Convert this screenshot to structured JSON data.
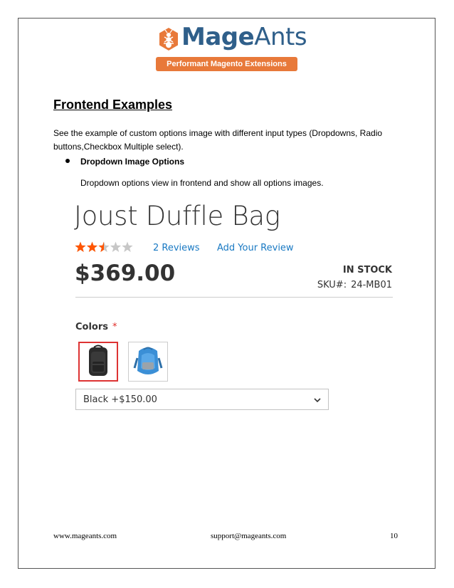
{
  "logo": {
    "brand_part1": "Mage",
    "brand_part2": "Ants",
    "tagline": "Performant Magento Extensions",
    "brand_color": "#2f5f8a",
    "accent_color": "#e8793a"
  },
  "document": {
    "section_title": "Frontend Examples",
    "intro": "See the example of custom options image with different input types (Dropdowns, Radio buttons,Checkbox Multiple select).",
    "bullet": {
      "label": "Dropdown Image Options",
      "description": "Dropdown options view in frontend and show all options images."
    }
  },
  "product": {
    "name": "Joust Duffle Bag",
    "rating": {
      "value": 2.5,
      "max": 5
    },
    "reviews_link": "2  Reviews",
    "add_review_link": "Add Your Review",
    "price": "$369.00",
    "stock_status": "IN STOCK",
    "sku_label": "SKU#:",
    "sku_value": "24-MB01",
    "option_label": "Colors",
    "required_marker": "*",
    "swatches": [
      {
        "icon": "black-backpack-icon",
        "selected": true
      },
      {
        "icon": "blue-backpack-icon",
        "selected": false
      }
    ],
    "select_value": "Black +$150.00",
    "link_color": "#1979c3",
    "required_color": "#e02b27",
    "star_color": "#ff5501"
  },
  "footer": {
    "website": "www.mageants.com",
    "email": "support@mageants.com",
    "page_number": "10"
  }
}
